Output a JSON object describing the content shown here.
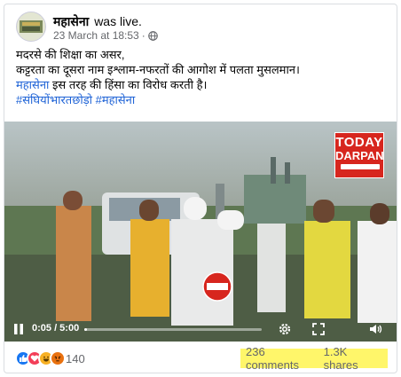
{
  "post": {
    "page_name": "महासेना",
    "status": "was live.",
    "date": "23 March at 18:53",
    "separator": "·",
    "privacy_icon": "globe-icon",
    "text_lines": [
      "मदरसे की शिक्षा का असर,",
      "कट्टरता का दूसरा नाम इश्लाम-नफरतों की आगोश में पलता मुसलमान।"
    ],
    "line3_link": "महासेना",
    "line3_rest": " इस तरह की हिंसा का विरोध करती है।",
    "hashtags": "#संघियोंभारतछोड़ो #महासेना"
  },
  "video": {
    "brand_line1": "TODAY",
    "brand_line2": "DARPAN",
    "time": "0:05 / 5:00",
    "progress_fraction": 0.017,
    "icons": [
      "pause-icon",
      "settings-icon",
      "volume-icon",
      "fullscreen-icon"
    ]
  },
  "footer": {
    "reaction_icons": [
      "like-icon",
      "love-icon",
      "haha-icon",
      "angry-icon"
    ],
    "reaction_count": "140",
    "comments": "236 comments",
    "shares": "1.3K shares"
  },
  "colors": {
    "link": "#1d62d6",
    "highlight": "#fff66a",
    "brand_red": "#d7261e",
    "secondary_text": "#65676b"
  }
}
